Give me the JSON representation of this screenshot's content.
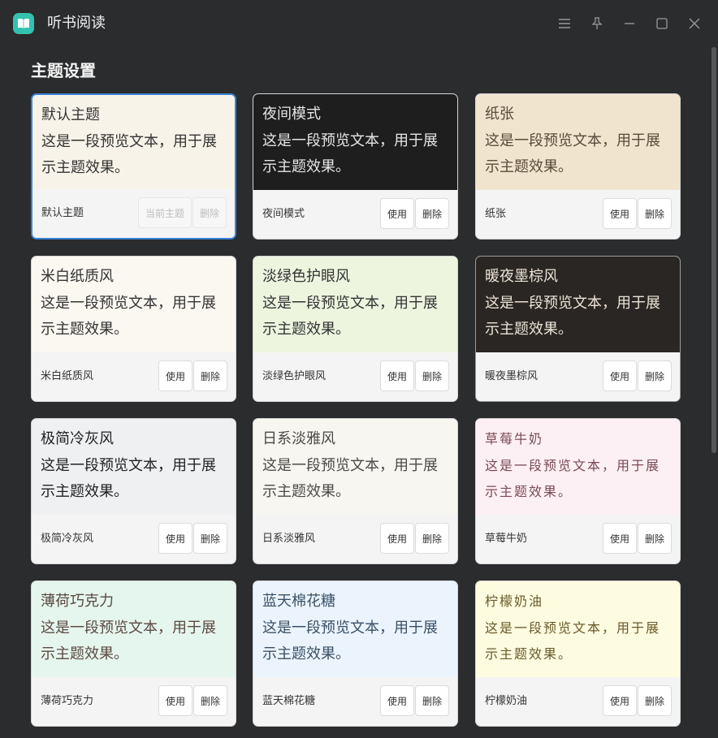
{
  "app": {
    "title": "听书阅读"
  },
  "page": {
    "section_title": "主题设置"
  },
  "preview_text": "这是一段预览文本，用于展示主题效果。",
  "buttons": {
    "use": "使用",
    "delete": "删除",
    "current": "当前主题"
  },
  "themes": [
    {
      "name": "默认主题",
      "bg": "#f7f3e8",
      "fg": "#333333",
      "selected": true
    },
    {
      "name": "夜间模式",
      "bg": "#1e1e1e",
      "fg": "#e6e6e6",
      "selected": false
    },
    {
      "name": "纸张",
      "bg": "#f0e4cf",
      "fg": "#5a4a3a",
      "selected": false
    },
    {
      "name": "米白纸质风",
      "bg": "#fbf8f2",
      "fg": "#333333",
      "selected": false
    },
    {
      "name": "淡绿色护眼风",
      "bg": "#edf5df",
      "fg": "#333333",
      "selected": false
    },
    {
      "name": "暖夜墨棕风",
      "bg": "#2a2623",
      "fg": "#ece4d8",
      "selected": false
    },
    {
      "name": "极简冷灰风",
      "bg": "#eff0f2",
      "fg": "#222222",
      "selected": false
    },
    {
      "name": "日系淡雅风",
      "bg": "#f8f6f0",
      "fg": "#4a4a4a",
      "selected": false
    },
    {
      "name": "草莓牛奶",
      "bg": "#fdf0f4",
      "fg": "#7a4a56",
      "selected": false
    },
    {
      "name": "薄荷巧克力",
      "bg": "#e5f6ee",
      "fg": "#5a4a42",
      "selected": false
    },
    {
      "name": "蓝天棉花糖",
      "bg": "#ebf4fd",
      "fg": "#3a5066",
      "selected": false
    },
    {
      "name": "柠檬奶油",
      "bg": "#fdfbe0",
      "fg": "#6a5a2a",
      "selected": false
    }
  ]
}
